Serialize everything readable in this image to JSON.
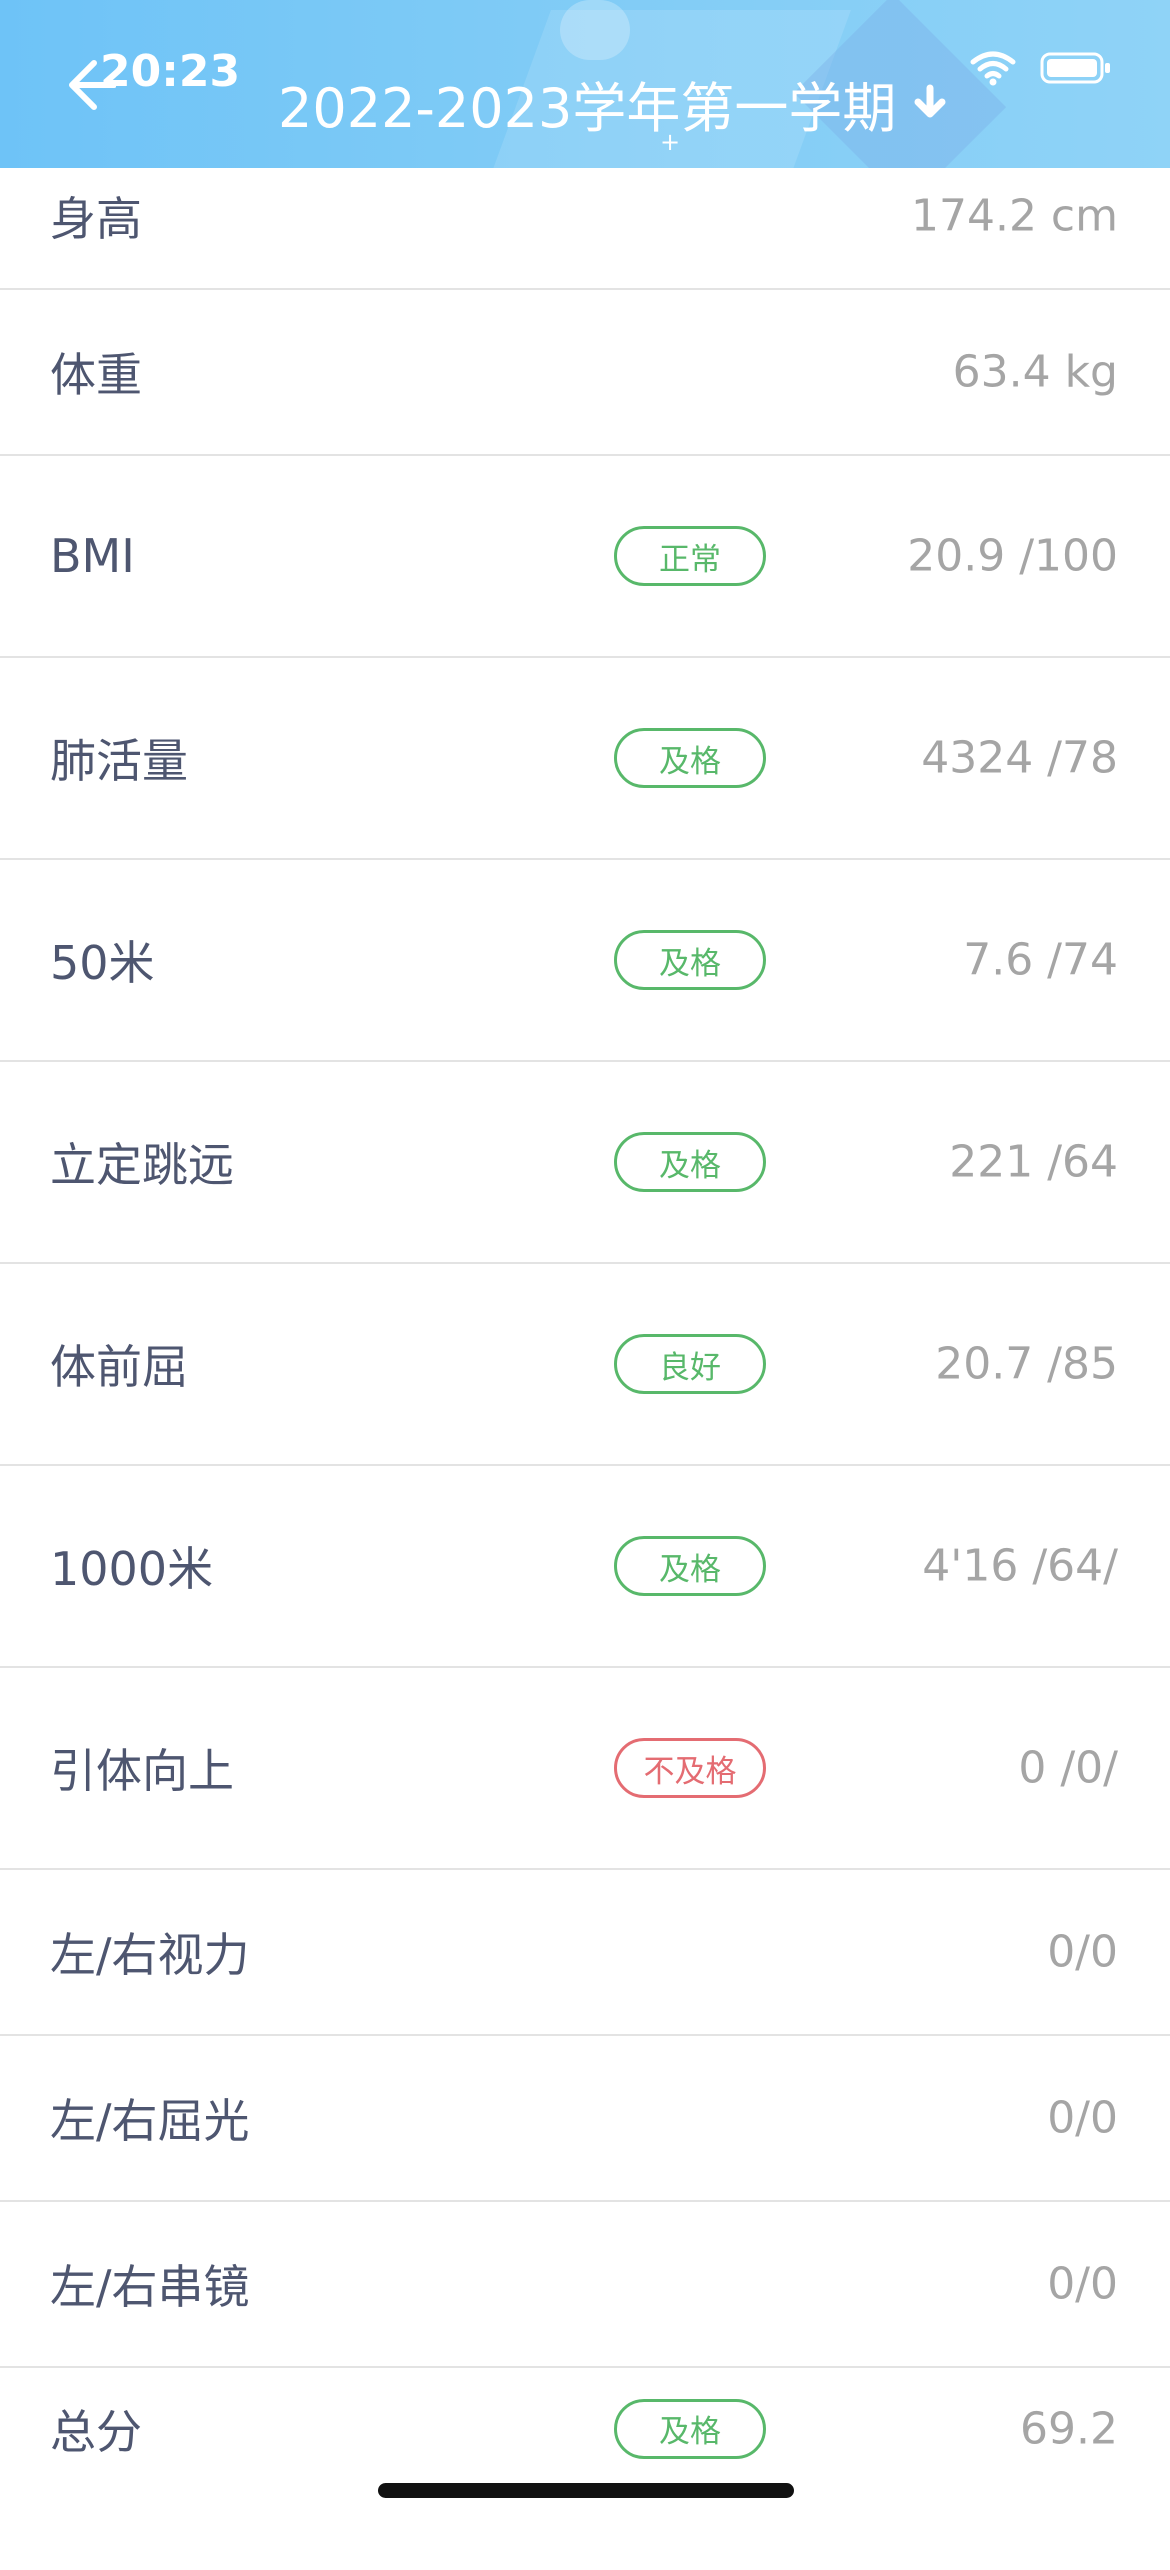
{
  "status_bar": {
    "time": "20:23"
  },
  "header": {
    "title": "2022-2023学年第一学期"
  },
  "rows": [
    {
      "label": "身高",
      "value": "174.2 cm"
    },
    {
      "label": "体重",
      "value": "63.4 kg"
    },
    {
      "label": "BMI",
      "badge": "正常",
      "value": "20.9 /100"
    },
    {
      "label": "肺活量",
      "badge": "及格",
      "value": "4324 /78"
    },
    {
      "label": "50米",
      "badge": "及格",
      "value": "7.6 /74"
    },
    {
      "label": "立定跳远",
      "badge": "及格",
      "value": "221 /64"
    },
    {
      "label": "体前屈",
      "badge": "良好",
      "value": "20.7 /85"
    },
    {
      "label": "1000米",
      "badge": "及格",
      "value": "4'16 /64/"
    },
    {
      "label": "引体向上",
      "badge": "不及格",
      "value": "0 /0/"
    },
    {
      "label": "左/右视力",
      "value": "0/0"
    },
    {
      "label": "左/右屈光",
      "value": "0/0"
    },
    {
      "label": "左/右串镜",
      "value": "0/0"
    },
    {
      "label": "总分",
      "badge": "及格",
      "value": "69.2"
    }
  ],
  "colors": {
    "header_gradient_start": "#6ec3f7",
    "badge_pass": "#58b86a",
    "badge_fail": "#e46c72",
    "label_text": "#4e5670",
    "value_text": "#a5a5a5"
  },
  "icons": [
    "back-arrow-icon",
    "chevron-down-icon",
    "wifi-icon",
    "battery-icon"
  ]
}
